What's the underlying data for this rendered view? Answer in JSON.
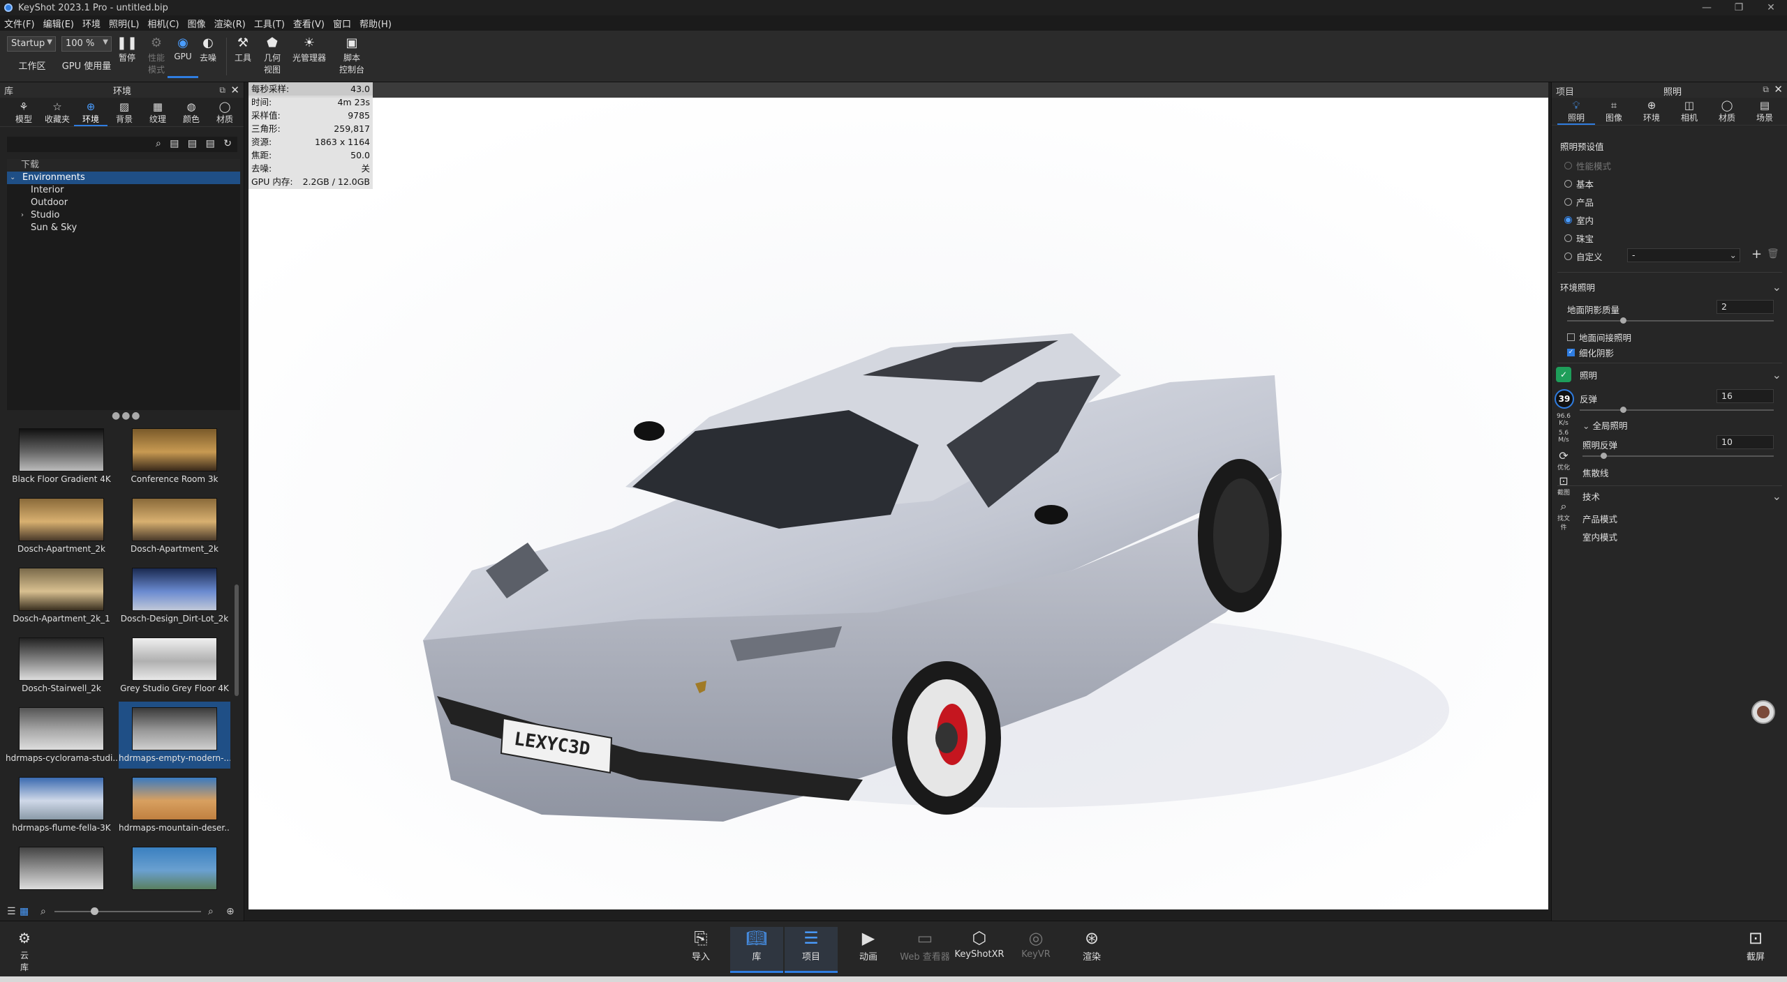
{
  "window": {
    "title": "KeyShot 2023.1 Pro  -  untitled.bip"
  },
  "menu": [
    "文件(F)",
    "编辑(E)",
    "环境",
    "照明(L)",
    "相机(C)",
    "图像",
    "渲染(R)",
    "工具(T)",
    "查看(V)",
    "窗口",
    "帮助(H)"
  ],
  "toolbar": {
    "workspace_value": "Startup",
    "workspace_label": "工作区",
    "zoom_value": "100 %",
    "gpu_usage_label": "GPU 使用量",
    "pause_label": "暂停",
    "perf_mode_label": "性能\n模式",
    "gpu_label": "GPU",
    "denoise_label": "去噪",
    "tools_label": "工具",
    "geometry_view_label": "几何\n视图",
    "light_manager_label": "光管理器",
    "script_console_label": "脚本\n控制台"
  },
  "library": {
    "panel_label": "库",
    "title": "环境",
    "tabs": [
      {
        "label": "模型",
        "icon": "models-icon"
      },
      {
        "label": "收藏夹",
        "icon": "star-icon"
      },
      {
        "label": "环境",
        "icon": "globe-icon"
      },
      {
        "label": "背景",
        "icon": "image-icon"
      },
      {
        "label": "纹理",
        "icon": "texture-icon"
      },
      {
        "label": "颜色",
        "icon": "palette-icon"
      },
      {
        "label": "材质",
        "icon": "material-icon"
      }
    ],
    "tree_header": "下载",
    "tree": [
      {
        "label": "Environments",
        "selected": true
      },
      {
        "label": "Interior"
      },
      {
        "label": "Outdoor"
      },
      {
        "label": "Studio",
        "expandable": true
      },
      {
        "label": "Sun & Sky"
      }
    ],
    "thumbnails": [
      "Black Floor Gradient 4K",
      "Conference Room 3k",
      "Dosch-Apartment_2k",
      "Dosch-Apartment_2k",
      "Dosch-Apartment_2k_1",
      "Dosch-Design_Dirt-Lot_2k",
      "Dosch-Stairwell_2k",
      "Grey Studio Grey Floor 4K",
      "hdrmaps-cyclorama-studi...",
      "hdrmaps-empty-modern-...",
      "hdrmaps-flume-fella-3K",
      "hdrmaps-mountain-deser...",
      "",
      ""
    ],
    "selected_thumbnail": 9
  },
  "stats": [
    {
      "k": "每秒采样:",
      "v": "43.0"
    },
    {
      "k": "时间:",
      "v": "4m 23s"
    },
    {
      "k": "采样值:",
      "v": "9785"
    },
    {
      "k": "三角形:",
      "v": "259,817"
    },
    {
      "k": "资源:",
      "v": "1863 x 1164"
    },
    {
      "k": "焦距:",
      "v": "50.0"
    },
    {
      "k": "去噪:",
      "v": "关"
    },
    {
      "k": "GPU 内存:",
      "v": "2.2GB / 12.0GB"
    }
  ],
  "viewport": {
    "plate_text": "LEXYC3D"
  },
  "project": {
    "panel_label": "项目",
    "title": "照明",
    "tabs": [
      {
        "label": "照明",
        "icon": "bulb-icon"
      },
      {
        "label": "图像",
        "icon": "crop-icon"
      },
      {
        "label": "环境",
        "icon": "globe-icon"
      },
      {
        "label": "相机",
        "icon": "camera-icon"
      },
      {
        "label": "材质",
        "icon": "material-icon"
      },
      {
        "label": "场景",
        "icon": "scene-icon"
      }
    ],
    "preset_title": "照明预设值",
    "presets": [
      {
        "label": "性能模式",
        "dim": true
      },
      {
        "label": "基本"
      },
      {
        "label": "产品"
      },
      {
        "label": "室内",
        "checked": true
      },
      {
        "label": "珠宝"
      },
      {
        "label": "自定义"
      }
    ],
    "custom_select": "-",
    "env_section": "环境照明",
    "ground_shadow_label": "地面阴影质量",
    "ground_shadow_value": "2",
    "ground_indirect_label": "地面间接照明",
    "refine_shadow_label": "细化阴影",
    "lighting_section": "照明",
    "bounce_label": "反弹",
    "bounce_value": "16",
    "global_illum_label": "全局照明",
    "gi_bounce_label": "照明反弹",
    "gi_bounce_value": "10",
    "caustics_label": "焦散线",
    "tech_section": "技术",
    "product_mode_label": "产品模式",
    "interior_mode_label": "室内模式",
    "overlay_percent": "39",
    "overlay_speed1": "96.6",
    "overlay_speed1_unit": "K/s",
    "overlay_speed2": "5.6",
    "overlay_speed2_unit": "M/s",
    "overlay_labels": [
      "优化",
      "截图",
      "找文件"
    ]
  },
  "bottom": {
    "cloud_label": "云\n库",
    "buttons": [
      {
        "label": "导入",
        "icon": "import-icon"
      },
      {
        "label": "库",
        "icon": "book-icon",
        "active": true
      },
      {
        "label": "项目",
        "icon": "list-icon",
        "active": true
      },
      {
        "label": "动画",
        "icon": "play-icon"
      },
      {
        "label": "Web 查看器",
        "icon": "monitor-icon",
        "dim": true
      },
      {
        "label": "KeyShotXR",
        "icon": "cube-icon"
      },
      {
        "label": "KeyVR",
        "icon": "vr-icon",
        "dim": true
      },
      {
        "label": "渲染",
        "icon": "render-icon"
      }
    ],
    "screenshot_label": "截屏"
  }
}
